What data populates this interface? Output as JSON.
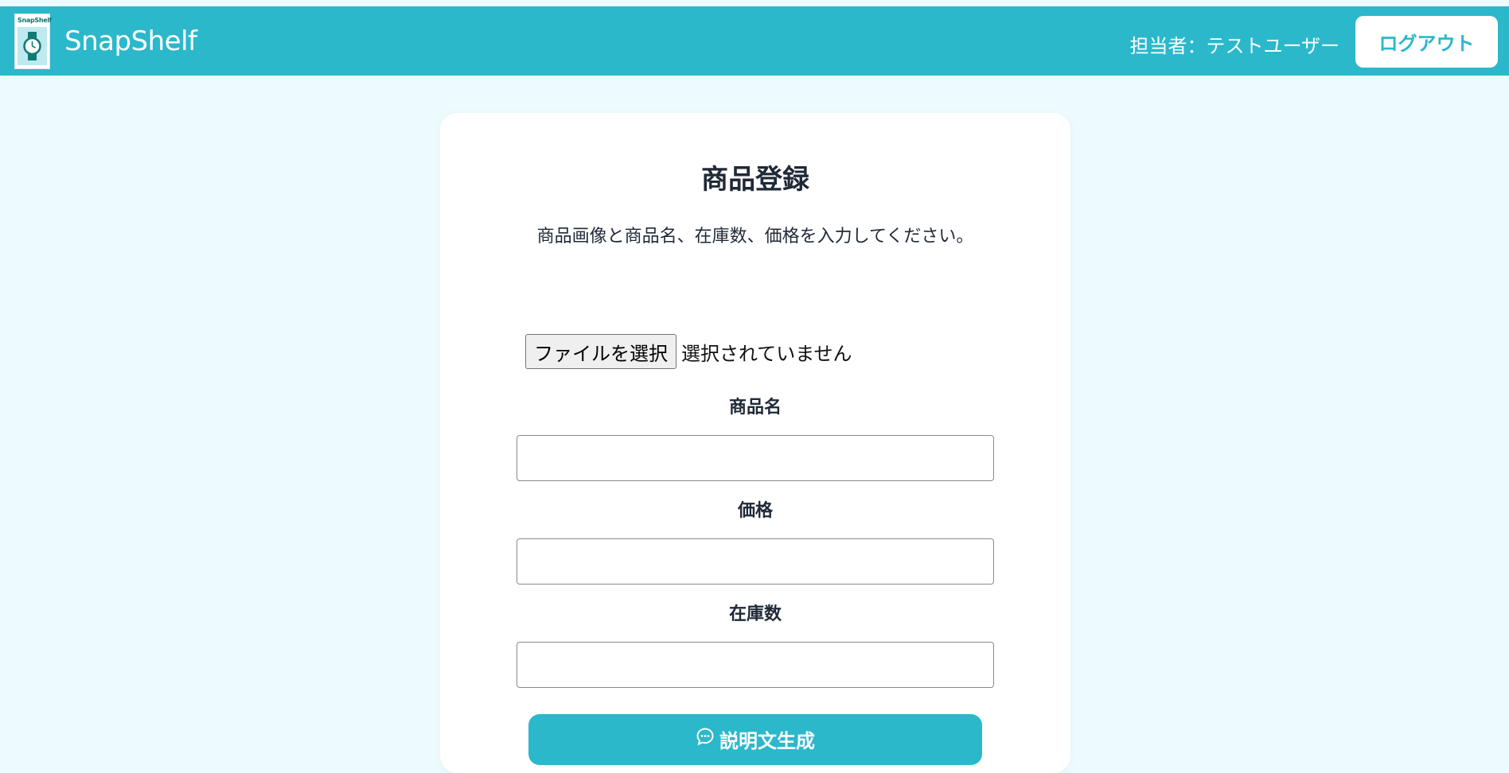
{
  "header": {
    "logo_mini_text": "SnapShelf",
    "brand": "SnapShelf",
    "user_label": "担当者：テストユーザー",
    "logout_label": "ログアウト",
    "accent_color": "#2bb8cb"
  },
  "form": {
    "title": "商品登録",
    "subtitle": "商品画像と商品名、在庫数、価格を入力してください。",
    "file_button_label": "ファイルを選択",
    "file_status": "選択されていません",
    "name_label": "商品名",
    "name_value": "",
    "price_label": "価格",
    "price_value": "",
    "stock_label": "在庫数",
    "stock_value": "",
    "generate_button_label": "説明文生成",
    "generate_icon": "chat-bubble-icon"
  }
}
